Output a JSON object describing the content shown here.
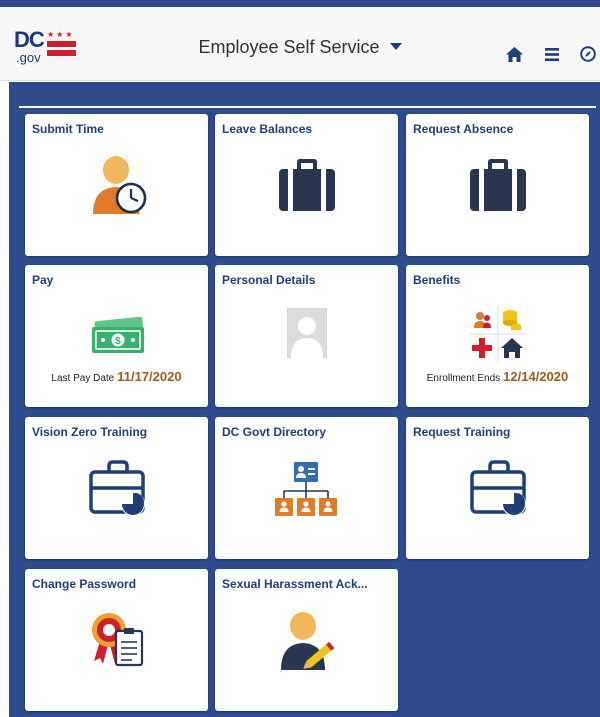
{
  "header": {
    "logo_text": "DC",
    "logo_sub": ".gov",
    "title": "Employee Self Service",
    "icons": [
      "home-icon",
      "menu-icon",
      "navigator-icon"
    ]
  },
  "tiles": [
    {
      "title": "Submit Time",
      "icon": "employee-clock-icon"
    },
    {
      "title": "Leave Balances",
      "icon": "briefcase-icon"
    },
    {
      "title": "Request Absence",
      "icon": "briefcase-icon"
    },
    {
      "title": "Pay",
      "icon": "money-icon",
      "footer_label": "Last Pay Date",
      "footer_value": "11/17/2020"
    },
    {
      "title": "Personal Details",
      "icon": "profile-photo-icon"
    },
    {
      "title": "Benefits",
      "icon": "benefits-icon",
      "footer_label": "Enrollment Ends",
      "footer_value": "12/14/2020"
    },
    {
      "title": "Vision Zero Training",
      "icon": "training-briefcase-icon"
    },
    {
      "title": "DC Govt Directory",
      "icon": "org-chart-icon"
    },
    {
      "title": "Request Training",
      "icon": "training-briefcase-icon"
    },
    {
      "title": "Change Password",
      "icon": "certificate-icon"
    },
    {
      "title": "Sexual Harassment Ack...",
      "icon": "employee-sign-icon"
    }
  ],
  "colors": {
    "header_bg": "#f7f7f7",
    "main_bg": "#2c4c8c",
    "tile_title": "#1f3f7a",
    "accent_orange": "#e07b2a",
    "date_color": "#a15a1c",
    "red": "#d11d2c"
  }
}
